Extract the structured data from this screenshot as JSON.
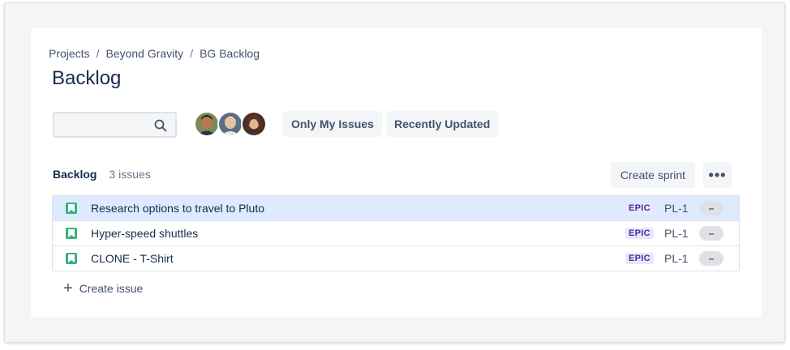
{
  "breadcrumb": {
    "items": [
      "Projects",
      "Beyond Gravity",
      "BG Backlog"
    ],
    "separator": "/"
  },
  "page_title": "Backlog",
  "search": {
    "placeholder": "",
    "value": "",
    "icon": "search-icon"
  },
  "filters": {
    "only_my_issues": "Only My Issues",
    "recently_updated": "Recently Updated"
  },
  "backlog": {
    "name": "Backlog",
    "count": "3 issues",
    "create_sprint": "Create sprint",
    "more": "•••",
    "issues": [
      {
        "summary": "Research options to travel to Pluto",
        "epic": "EPIC",
        "key": "PL-1",
        "estimate": "–",
        "selected": true
      },
      {
        "summary": "Hyper-speed shuttles",
        "epic": "EPIC",
        "key": "PL-1",
        "estimate": "–",
        "selected": false
      },
      {
        "summary": "CLONE - T-Shirt",
        "epic": "EPIC",
        "key": "PL-1",
        "estimate": "–",
        "selected": false
      }
    ],
    "create_issue": "Create issue"
  },
  "colors": {
    "story": "#36b37e",
    "selected_row": "#deebff",
    "epic_bg": "#eae6ff",
    "epic_text": "#403294"
  }
}
